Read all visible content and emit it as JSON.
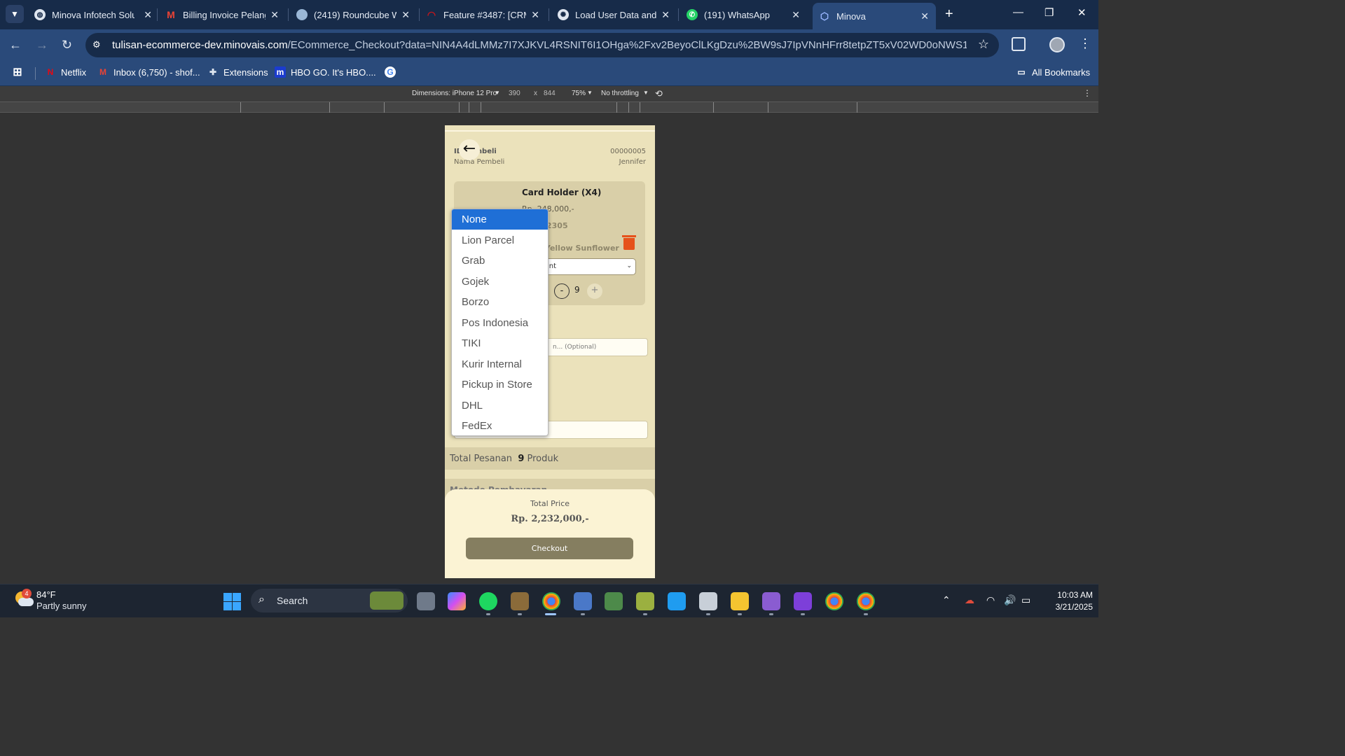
{
  "browser": {
    "tabs": [
      {
        "title": "Minova Infotech Solu",
        "icon": "globe-icon",
        "color": "#dfe6f0"
      },
      {
        "title": "Billing Invoice Pelang",
        "icon": "gmail-icon",
        "color": "#ea4335"
      },
      {
        "title": "(2419) Roundcube W",
        "icon": "roundcube-icon",
        "color": "#9ab7d6"
      },
      {
        "title": "Feature #3487: [CRM",
        "icon": "redmine-icon",
        "color": "#c4161c"
      },
      {
        "title": "Load User Data and \\",
        "icon": "openai-icon",
        "color": "#dfe6f0"
      },
      {
        "title": "(191) WhatsApp",
        "icon": "whatsapp-icon",
        "color": "#25d366"
      },
      {
        "title": "Minova",
        "icon": "minova-icon",
        "color": "#6f8fd8",
        "active": true
      }
    ],
    "url_host": "tulisan-ecommerce-dev.minovais.com",
    "url_path": "/ECommerce_Checkout?data=NIN4A4dLMMz7I7XJKVL4RSNIT6I1OHga%2Fxv2BeyoClLKgDzu%2BW9sJ7IpVNnHFrr8tetpZT5xV02WD0oNWS1rH%2Bi51%2...",
    "bookmarks": [
      {
        "label": "Netflix",
        "icon": "netflix-icon"
      },
      {
        "label": "Inbox (6,750) - shof...",
        "icon": "gmail-icon"
      },
      {
        "label": "Extensions",
        "icon": "puzzle-icon"
      },
      {
        "label": "HBO GO. It's HBO....",
        "icon": "hbo-icon"
      },
      {
        "label": "",
        "icon": "google-icon"
      }
    ],
    "all_bookmarks": "All Bookmarks"
  },
  "devtools": {
    "dimensions_label": "Dimensions: iPhone 12 Pro",
    "width": "390",
    "times": "x",
    "height": "844",
    "zoom": "75%",
    "throttling": "No throttling"
  },
  "page": {
    "id_pembeli_label": "ID Pembeli",
    "id_pembeli_value": "00000005",
    "nama_pembeli_label": "Nama Pembeli",
    "nama_pembeli_value": "Jennifer",
    "product": {
      "name": "Card Holder (X4)",
      "price": "Rp. 248,000,-",
      "code": "2305",
      "variant": "Yellow Sunflower",
      "discount_placeholder": "t Discount",
      "qty": "9",
      "minus": "-",
      "plus": "+"
    },
    "note_placeholder": "n... (Optional)",
    "total_pesanan_label": "Total Pesanan",
    "total_pesanan_count": "9",
    "total_pesanan_unit": "Produk",
    "metode_pembayaran": "Metode Pembayaran",
    "total_price_label": "Total Price",
    "total_price_value": "Rp.  2,232,000,-",
    "checkout_label": "Checkout"
  },
  "courier_dropdown": {
    "selected": "None",
    "options": [
      "None",
      "Lion Parcel",
      "Grab",
      "Gojek",
      "Borzo",
      "Pos Indonesia",
      "TIKI",
      "Kurir Internal",
      "Pickup in Store",
      "DHL",
      "FedEx"
    ]
  },
  "taskbar": {
    "weather_temp": "84°F",
    "weather_desc": "Partly sunny",
    "weather_badge": "4",
    "search_label": "Search",
    "time": "10:03 AM",
    "date": "3/21/2025"
  }
}
